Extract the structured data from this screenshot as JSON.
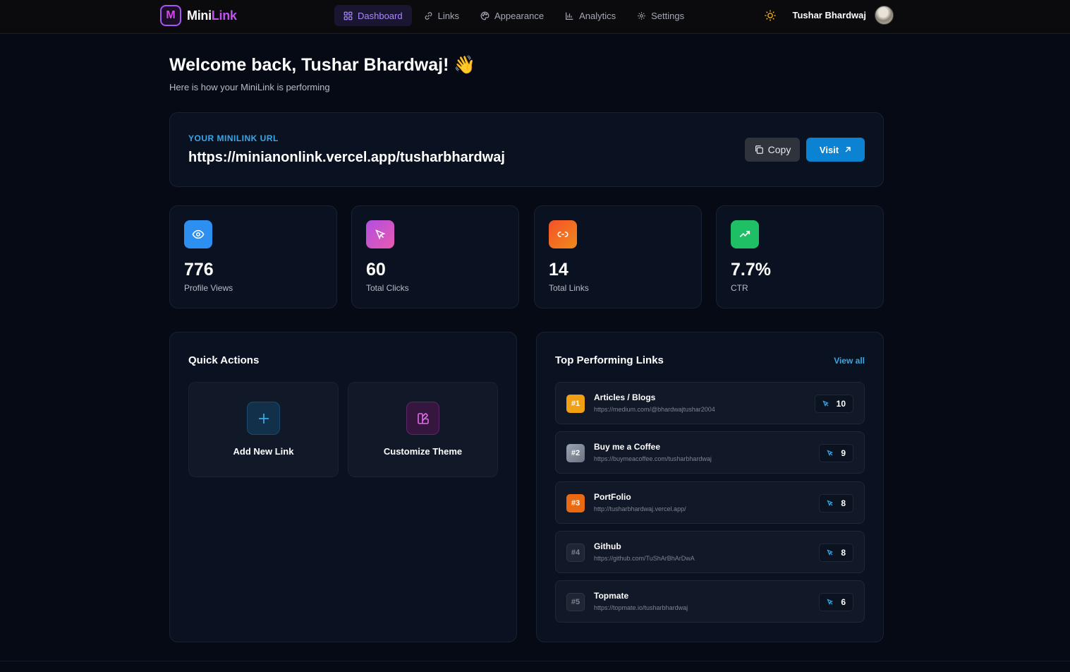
{
  "brand": {
    "badge": "M",
    "mini": "Mini",
    "link": "Link"
  },
  "nav": [
    {
      "label": "Dashboard",
      "icon": "grid-icon",
      "active": true
    },
    {
      "label": "Links",
      "icon": "link-icon"
    },
    {
      "label": "Appearance",
      "icon": "palette-icon"
    },
    {
      "label": "Analytics",
      "icon": "bar-chart-icon"
    },
    {
      "label": "Settings",
      "icon": "gear-icon"
    }
  ],
  "user": {
    "name": "Tushar Bhardwaj"
  },
  "welcome": {
    "title": "Welcome back, Tushar Bhardwaj! 👋",
    "subtitle": "Here is how your MiniLink is performing"
  },
  "url_card": {
    "label": "YOUR MINILINK URL",
    "url": "https://minianonlink.vercel.app/tusharbhardwaj",
    "copy_label": "Copy",
    "visit_label": "Visit"
  },
  "stats": [
    {
      "value": "776",
      "label": "Profile Views",
      "icon": "eye-icon",
      "color": "#2d8ff0"
    },
    {
      "value": "60",
      "label": "Total Clicks",
      "icon": "cursor-icon",
      "color": "#c84fd8"
    },
    {
      "value": "14",
      "label": "Total Links",
      "icon": "link-icon",
      "color": "#f26a24"
    },
    {
      "value": "7.7%",
      "label": "CTR",
      "icon": "trending-up-icon",
      "color": "#1fbf65"
    }
  ],
  "quick_actions": {
    "title": "Quick Actions",
    "items": [
      {
        "label": "Add New Link",
        "icon": "plus-icon"
      },
      {
        "label": "Customize Theme",
        "icon": "swatch-icon"
      }
    ]
  },
  "top_links": {
    "title": "Top Performing Links",
    "view_all": "View all",
    "items": [
      {
        "rank": "#1",
        "title": "Articles / Blogs",
        "url": "https://medium.com/@bhardwajtushar2004",
        "clicks": "10",
        "color": "#f0a012"
      },
      {
        "rank": "#2",
        "title": "Buy me a Coffee",
        "url": "https://buymeacoffee.com/tusharbhardwaj",
        "clicks": "9",
        "color": "#8a93a3"
      },
      {
        "rank": "#3",
        "title": "PortFolio",
        "url": "http://tusharbhardwaj.vercel.app/",
        "clicks": "8",
        "color": "#ea6a14"
      },
      {
        "rank": "#4",
        "title": "Github",
        "url": "https://github.com/TuShArBhArDwA",
        "clicks": "8",
        "color": "#1e2533"
      },
      {
        "rank": "#5",
        "title": "Topmate",
        "url": "https://topmate.io/tusharbhardwaj",
        "clicks": "6",
        "color": "#1e2533"
      }
    ]
  }
}
